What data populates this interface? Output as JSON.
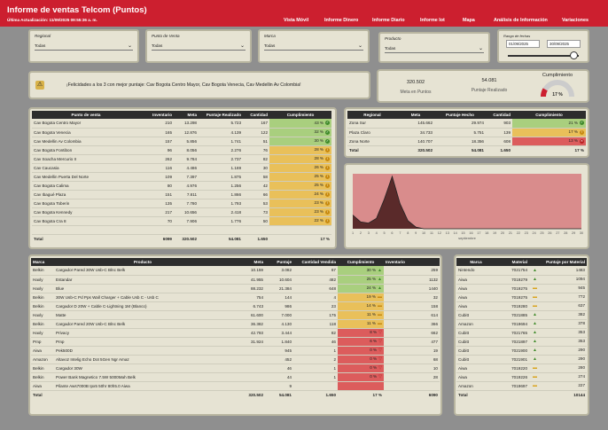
{
  "header": {
    "title": "Informe de ventas Telcom (Puntos)",
    "updated": "Última Actualización: 11/09/2025 09:55:36 a. m.",
    "nav": [
      "Vista Móvil",
      "Informe Dinero",
      "Informe Diario",
      "Informe Iot",
      "Mapa",
      "Análisis de Información",
      "Variaciones"
    ]
  },
  "filters": {
    "regional": {
      "label": "Regional",
      "value": "Todas"
    },
    "punto": {
      "label": "Punto de Venta",
      "value": "Todas"
    },
    "marca": {
      "label": "Marca",
      "value": "Todas"
    },
    "producto": {
      "label": "Producto",
      "value": "Todas"
    },
    "fecha": {
      "label": "Rango de fechas",
      "from": "01/09/2025",
      "to": "30/09/2025"
    }
  },
  "banner": {
    "icon": "warning-icon",
    "text": "¡Felicidades a los 3 con mejor puntaje: Cav Bogota Centro Mayor, Cav Bogota Venecia, Cav Medellin Av Colombia!"
  },
  "kpis": {
    "meta": {
      "value": "320.502",
      "label": "Meta en Puntos"
    },
    "puntaje": {
      "value": "54.081",
      "label": "Puntaje Realizado"
    },
    "cumplimiento": {
      "label": "Cumplimiento",
      "value": "17 %",
      "fraction": 0.17
    }
  },
  "colors": {
    "accent": "#cc1f2f",
    "good": "#a9cf7e",
    "warn": "#e9c05a",
    "mid": "#ee9e5a",
    "bad": "#dc5c5c"
  },
  "puntos": {
    "headers": [
      "Punto de venta",
      "Inventario",
      "Meta",
      "Puntaje Realizado",
      "Cantidad",
      "Cumplimiento"
    ],
    "rows": [
      [
        "Cav Bogota Centro Mayor",
        "210",
        "13.298",
        "5.723",
        "167",
        "43 %",
        "g"
      ],
      [
        "Cav Bogota Venecia",
        "165",
        "12.876",
        "4.139",
        "122",
        "32 %",
        "g"
      ],
      [
        "Cav Medellin Av Colombia",
        "157",
        "5.856",
        "1.741",
        "51",
        "30 %",
        "g"
      ],
      [
        "Cav Bogota Fontibon",
        "96",
        "8.056",
        "2.276",
        "76",
        "28 %",
        "y"
      ],
      [
        "Cav Soacha Mercurio II",
        "262",
        "9.784",
        "2.737",
        "82",
        "28 %",
        "y"
      ],
      [
        "Cav Caucasia",
        "116",
        "4.486",
        "1.169",
        "30",
        "26 %",
        "y"
      ],
      [
        "Cav Medellin Puerta Del Norte",
        "109",
        "7.397",
        "1.875",
        "58",
        "25 %",
        "y"
      ],
      [
        "Cav Bogota Calima",
        "80",
        "4.976",
        "1.256",
        "42",
        "25 %",
        "y"
      ],
      [
        "Cav Ibagué Plaza",
        "151",
        "7.811",
        "1.866",
        "66",
        "24 %",
        "y"
      ],
      [
        "Cav Bogota Toberin",
        "135",
        "7.780",
        "1.793",
        "53",
        "23 %",
        "y"
      ],
      [
        "Cav Bogota Kennedy",
        "217",
        "10.656",
        "2.418",
        "73",
        "23 %",
        "y"
      ],
      [
        "Cav Bogota Cra 8",
        "70",
        "7.906",
        "1.776",
        "50",
        "22 %",
        "y"
      ]
    ],
    "total": [
      "Total",
      "6099",
      "320.502",
      "54.081",
      "1.650",
      "17 %"
    ]
  },
  "regional": {
    "headers": [
      "Regional",
      "Meta",
      "Puntaje Hecho",
      "Cantidad",
      "Cumplimiento"
    ],
    "rows": [
      [
        "Zona Sur",
        "145.662",
        "29.974",
        "903",
        "21 %",
        "g"
      ],
      [
        "Plaza Claro",
        "34.733",
        "5.751",
        "139",
        "17 %",
        "y"
      ],
      [
        "Zona Norte",
        "140.707",
        "18.356",
        "608",
        "13 %",
        "r"
      ]
    ],
    "total": [
      "Total",
      "320.502",
      "54.081",
      "1.650",
      "17 %"
    ]
  },
  "area_chart": {
    "xlabel": "septiembre",
    "x": [
      1,
      2,
      3,
      4,
      5,
      6,
      7,
      8,
      9,
      10,
      11,
      12,
      13,
      14,
      15,
      16,
      17,
      18,
      19,
      20,
      21,
      22,
      23,
      24,
      25,
      26,
      27,
      28,
      29,
      30
    ],
    "values": [
      1200,
      600,
      500,
      900,
      2600,
      4600,
      2200,
      700,
      150,
      0,
      0,
      0,
      0,
      0,
      0,
      0,
      0,
      0,
      0,
      0,
      0,
      0,
      0,
      0,
      0,
      0,
      0,
      0,
      0,
      0
    ]
  },
  "productos": {
    "headers": [
      "Marca",
      "Producto",
      "Meta",
      "Puntaje",
      "Cantidad Vendida",
      "Cumplimiento",
      "Inventario"
    ],
    "rows": [
      [
        "Belkin",
        "Cargador Pared 30W Usb-C Blnc Belk",
        "10.159",
        "3.082",
        "67",
        "30 %",
        "g",
        "259"
      ],
      [
        "Haxly",
        "Estandar",
        "41.955",
        "10.604",
        "482",
        "25 %",
        "g",
        "1132"
      ],
      [
        "Haxly",
        "Blue",
        "88.232",
        "21.384",
        "648",
        "24 %",
        "g",
        "1440"
      ],
      [
        "Belkin",
        "30W Usb-C Pd Pps Wall Charger + Cable Usb C - Usb C",
        "754",
        "144",
        "4",
        "19 %",
        "y",
        "32"
      ],
      [
        "Belkin",
        "Cargador D 20W + Cable C-Lightning 1M (Blanco)",
        "6.743",
        "986",
        "23",
        "14 %",
        "y",
        "158"
      ],
      [
        "Haxly",
        "Matte",
        "61.600",
        "7.000",
        "175",
        "11 %",
        "y",
        "614"
      ],
      [
        "Belkin",
        "Cargador Pared 20W Usb-C Blnc Belk",
        "36.382",
        "4.130",
        "118",
        "11 %",
        "y",
        "366"
      ],
      [
        "Haxly",
        "Privacy",
        "42.793",
        "3.444",
        "82",
        "8 %",
        "r",
        "662"
      ],
      [
        "Pmp",
        "Pmp",
        "31.924",
        "1.840",
        "46",
        "6 %",
        "r",
        "477"
      ],
      [
        "Aiwa",
        "Pek500D",
        "",
        "945",
        "1",
        "0 %",
        "r",
        "19"
      ],
      [
        "Amazon",
        "Altavoz Intelig Echo Dot 5Gen Ngr Amaz",
        "",
        "452",
        "2",
        "0 %",
        "r",
        "68"
      ],
      [
        "Belkin",
        "Cargador 30W",
        "",
        "46",
        "1",
        "0 %",
        "r",
        "10"
      ],
      [
        "Belkin",
        "Power Bank Magnetico 7.5W 5000Mah Belk",
        "",
        "44",
        "1",
        "0 %",
        "r",
        "28"
      ],
      [
        "Aiwa",
        "Pilante Aws7000B Ipx5 50hr 80h5.0 Aiwa",
        "",
        "9",
        "",
        "",
        "r",
        ""
      ]
    ],
    "total": [
      "Total",
      "",
      "320.502",
      "54.081",
      "1.650",
      "17 %",
      "6090"
    ]
  },
  "material": {
    "headers": [
      "Marca",
      "Material",
      "Puntaje por Material"
    ],
    "rows": [
      [
        "Nintendo",
        "7021754",
        "1483",
        "u"
      ],
      [
        "Aiwa",
        "7019279",
        "1094",
        "u"
      ],
      [
        "Aiwa",
        "7019275",
        "945",
        "m"
      ],
      [
        "Aiwa",
        "7019275",
        "772",
        "m"
      ],
      [
        "Aiwa",
        "7019280",
        "637",
        "m"
      ],
      [
        "Cubitt",
        "7021885",
        "382",
        "u"
      ],
      [
        "Amazon",
        "7019694",
        "378",
        "u"
      ],
      [
        "Cubitt",
        "7021765",
        "353",
        "u"
      ],
      [
        "Cubitt",
        "7021897",
        "353",
        "u"
      ],
      [
        "Cubitt",
        "7021900",
        "290",
        "u"
      ],
      [
        "Cubitt",
        "7021901",
        "290",
        "u"
      ],
      [
        "Aiwa",
        "7019220",
        "280",
        "m"
      ],
      [
        "Aiwa",
        "7019226",
        "274",
        "m"
      ],
      [
        "Amazon",
        "7019697",
        "227",
        "m"
      ]
    ],
    "total": [
      "Total",
      "",
      "10144"
    ]
  }
}
